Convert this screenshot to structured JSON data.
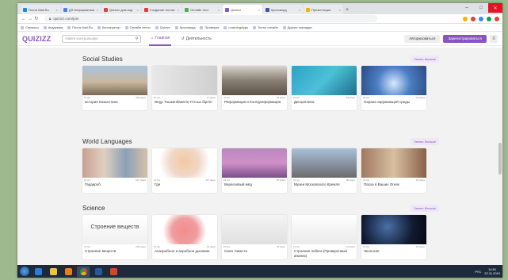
{
  "browser": {
    "tabs": [
      {
        "label": "Почта Mail.Ru",
        "color": "#168de2",
        "active": false
      },
      {
        "label": "ДЗ Информатика",
        "color": "#4285f4",
        "active": false
      },
      {
        "label": "Quizizz дом.зад",
        "color": "#db4437",
        "active": false
      },
      {
        "label": "Создание тестов",
        "color": "#e53935",
        "active": false
      },
      {
        "label": "Онлайн тест",
        "color": "#4caf50",
        "active": false
      },
      {
        "label": "Quizizz",
        "color": "#8854c0",
        "active": true
      },
      {
        "label": "Кроссворд",
        "color": "#3f51b5",
        "active": false
      },
      {
        "label": "Презентация",
        "color": "#f4b400",
        "active": false
      }
    ],
    "new_tab": "+",
    "url": "quizizz.com/join",
    "bookmarks": [
      "Сервисы",
      "Академия",
      "Почта Mail.Ru",
      "Конструктор",
      "Онлайн тесты",
      "Quizizz",
      "Кроссворд",
      "Проверка",
      "LearningApps",
      "Тесты онлайн",
      "Другие закладки"
    ]
  },
  "app": {
    "logo": "QUIZIZZ",
    "search_placeholder": "Найти контрольную",
    "search_icon": "search-icon",
    "nav": [
      {
        "label": "Главная",
        "icon": "home-icon",
        "active": true
      },
      {
        "label": "Деятельность",
        "icon": "history-icon",
        "active": false
      }
    ],
    "login": "Авторизоваться",
    "signup": "Зарегистрироваться"
  },
  "sections": [
    {
      "title": "Social Studies",
      "more": "Узнать больше",
      "cards": [
        {
          "title": "история Казахстана",
          "questions": "10 Qs",
          "plays": "300 plays"
        },
        {
          "title": "Әнұр Тәшкенбаевтің Ұлтсыз бірлігі",
          "questions": "10 Qs",
          "plays": "12 plays"
        },
        {
          "title": "Реформация и Контрреформация",
          "questions": "20 Qs",
          "plays": "95 plays"
        },
        {
          "title": "Дисциплина",
          "questions": "10 Qs",
          "plays": "54 plays"
        },
        {
          "title": "Охрана окружающей среды",
          "questions": "15 Qs",
          "plays": "41 plays"
        }
      ]
    },
    {
      "title": "World Languages",
      "more": "Узнать больше",
      "cards": [
        {
          "title": "Гардероб",
          "questions": "10 Qs",
          "plays": "527 plays"
        },
        {
          "title": "Где",
          "questions": "10 Qs",
          "plays": "117 plays"
        },
        {
          "title": "Вересковый мёд",
          "questions": "14 Qs",
          "plays": "46 plays"
        },
        {
          "title": "Музеи Московского Кремля",
          "questions": "12 Qs",
          "plays": "88 plays"
        },
        {
          "title": "Пасха в Ваших Огнях",
          "questions": "10 Qs",
          "plays": "29 plays"
        }
      ]
    },
    {
      "title": "Science",
      "more": "Узнать больше",
      "cards": [
        {
          "title": "Строение веществ",
          "questions": "10 Qs",
          "plays": "200 plays",
          "overlay": "Строение веществ"
        },
        {
          "title": "Анаэробное и аэробное дыхание",
          "questions": "10 Qs",
          "plays": "51 plays"
        },
        {
          "title": "Сила тяжести",
          "questions": "10 Qs",
          "plays": "78 plays"
        },
        {
          "title": "Строение побега (Проверочный анализ)",
          "questions": "12 Qs",
          "plays": "34 plays"
        },
        {
          "title": "Экология",
          "questions": "10 Qs",
          "plays": "62 plays"
        }
      ]
    }
  ],
  "taskbar": {
    "lang": "РУС",
    "time": "14:51",
    "date": "22.11.2019"
  }
}
